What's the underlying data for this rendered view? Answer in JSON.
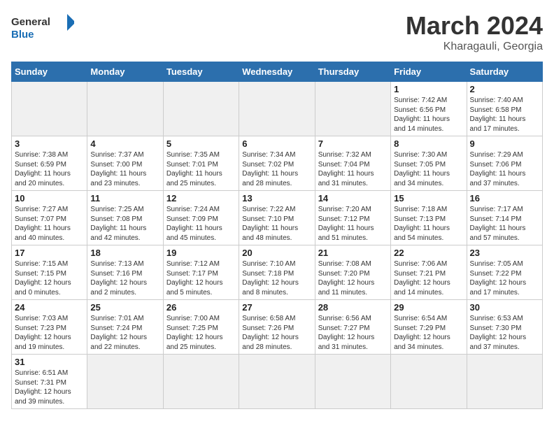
{
  "header": {
    "logo_general": "General",
    "logo_blue": "Blue",
    "month_year": "March 2024",
    "location": "Kharagauli, Georgia"
  },
  "days_of_week": [
    "Sunday",
    "Monday",
    "Tuesday",
    "Wednesday",
    "Thursday",
    "Friday",
    "Saturday"
  ],
  "weeks": [
    [
      {
        "day": "",
        "info": "",
        "empty": true
      },
      {
        "day": "",
        "info": "",
        "empty": true
      },
      {
        "day": "",
        "info": "",
        "empty": true
      },
      {
        "day": "",
        "info": "",
        "empty": true
      },
      {
        "day": "",
        "info": "",
        "empty": true
      },
      {
        "day": "1",
        "info": "Sunrise: 7:42 AM\nSunset: 6:56 PM\nDaylight: 11 hours\nand 14 minutes.",
        "empty": false
      },
      {
        "day": "2",
        "info": "Sunrise: 7:40 AM\nSunset: 6:58 PM\nDaylight: 11 hours\nand 17 minutes.",
        "empty": false
      }
    ],
    [
      {
        "day": "3",
        "info": "Sunrise: 7:38 AM\nSunset: 6:59 PM\nDaylight: 11 hours\nand 20 minutes.",
        "empty": false
      },
      {
        "day": "4",
        "info": "Sunrise: 7:37 AM\nSunset: 7:00 PM\nDaylight: 11 hours\nand 23 minutes.",
        "empty": false
      },
      {
        "day": "5",
        "info": "Sunrise: 7:35 AM\nSunset: 7:01 PM\nDaylight: 11 hours\nand 25 minutes.",
        "empty": false
      },
      {
        "day": "6",
        "info": "Sunrise: 7:34 AM\nSunset: 7:02 PM\nDaylight: 11 hours\nand 28 minutes.",
        "empty": false
      },
      {
        "day": "7",
        "info": "Sunrise: 7:32 AM\nSunset: 7:04 PM\nDaylight: 11 hours\nand 31 minutes.",
        "empty": false
      },
      {
        "day": "8",
        "info": "Sunrise: 7:30 AM\nSunset: 7:05 PM\nDaylight: 11 hours\nand 34 minutes.",
        "empty": false
      },
      {
        "day": "9",
        "info": "Sunrise: 7:29 AM\nSunset: 7:06 PM\nDaylight: 11 hours\nand 37 minutes.",
        "empty": false
      }
    ],
    [
      {
        "day": "10",
        "info": "Sunrise: 7:27 AM\nSunset: 7:07 PM\nDaylight: 11 hours\nand 40 minutes.",
        "empty": false
      },
      {
        "day": "11",
        "info": "Sunrise: 7:25 AM\nSunset: 7:08 PM\nDaylight: 11 hours\nand 42 minutes.",
        "empty": false
      },
      {
        "day": "12",
        "info": "Sunrise: 7:24 AM\nSunset: 7:09 PM\nDaylight: 11 hours\nand 45 minutes.",
        "empty": false
      },
      {
        "day": "13",
        "info": "Sunrise: 7:22 AM\nSunset: 7:10 PM\nDaylight: 11 hours\nand 48 minutes.",
        "empty": false
      },
      {
        "day": "14",
        "info": "Sunrise: 7:20 AM\nSunset: 7:12 PM\nDaylight: 11 hours\nand 51 minutes.",
        "empty": false
      },
      {
        "day": "15",
        "info": "Sunrise: 7:18 AM\nSunset: 7:13 PM\nDaylight: 11 hours\nand 54 minutes.",
        "empty": false
      },
      {
        "day": "16",
        "info": "Sunrise: 7:17 AM\nSunset: 7:14 PM\nDaylight: 11 hours\nand 57 minutes.",
        "empty": false
      }
    ],
    [
      {
        "day": "17",
        "info": "Sunrise: 7:15 AM\nSunset: 7:15 PM\nDaylight: 12 hours\nand 0 minutes.",
        "empty": false
      },
      {
        "day": "18",
        "info": "Sunrise: 7:13 AM\nSunset: 7:16 PM\nDaylight: 12 hours\nand 2 minutes.",
        "empty": false
      },
      {
        "day": "19",
        "info": "Sunrise: 7:12 AM\nSunset: 7:17 PM\nDaylight: 12 hours\nand 5 minutes.",
        "empty": false
      },
      {
        "day": "20",
        "info": "Sunrise: 7:10 AM\nSunset: 7:18 PM\nDaylight: 12 hours\nand 8 minutes.",
        "empty": false
      },
      {
        "day": "21",
        "info": "Sunrise: 7:08 AM\nSunset: 7:20 PM\nDaylight: 12 hours\nand 11 minutes.",
        "empty": false
      },
      {
        "day": "22",
        "info": "Sunrise: 7:06 AM\nSunset: 7:21 PM\nDaylight: 12 hours\nand 14 minutes.",
        "empty": false
      },
      {
        "day": "23",
        "info": "Sunrise: 7:05 AM\nSunset: 7:22 PM\nDaylight: 12 hours\nand 17 minutes.",
        "empty": false
      }
    ],
    [
      {
        "day": "24",
        "info": "Sunrise: 7:03 AM\nSunset: 7:23 PM\nDaylight: 12 hours\nand 19 minutes.",
        "empty": false
      },
      {
        "day": "25",
        "info": "Sunrise: 7:01 AM\nSunset: 7:24 PM\nDaylight: 12 hours\nand 22 minutes.",
        "empty": false
      },
      {
        "day": "26",
        "info": "Sunrise: 7:00 AM\nSunset: 7:25 PM\nDaylight: 12 hours\nand 25 minutes.",
        "empty": false
      },
      {
        "day": "27",
        "info": "Sunrise: 6:58 AM\nSunset: 7:26 PM\nDaylight: 12 hours\nand 28 minutes.",
        "empty": false
      },
      {
        "day": "28",
        "info": "Sunrise: 6:56 AM\nSunset: 7:27 PM\nDaylight: 12 hours\nand 31 minutes.",
        "empty": false
      },
      {
        "day": "29",
        "info": "Sunrise: 6:54 AM\nSunset: 7:29 PM\nDaylight: 12 hours\nand 34 minutes.",
        "empty": false
      },
      {
        "day": "30",
        "info": "Sunrise: 6:53 AM\nSunset: 7:30 PM\nDaylight: 12 hours\nand 37 minutes.",
        "empty": false
      }
    ],
    [
      {
        "day": "31",
        "info": "Sunrise: 6:51 AM\nSunset: 7:31 PM\nDaylight: 12 hours\nand 39 minutes.",
        "empty": false
      },
      {
        "day": "",
        "info": "",
        "empty": true
      },
      {
        "day": "",
        "info": "",
        "empty": true
      },
      {
        "day": "",
        "info": "",
        "empty": true
      },
      {
        "day": "",
        "info": "",
        "empty": true
      },
      {
        "day": "",
        "info": "",
        "empty": true
      },
      {
        "day": "",
        "info": "",
        "empty": true
      }
    ]
  ]
}
